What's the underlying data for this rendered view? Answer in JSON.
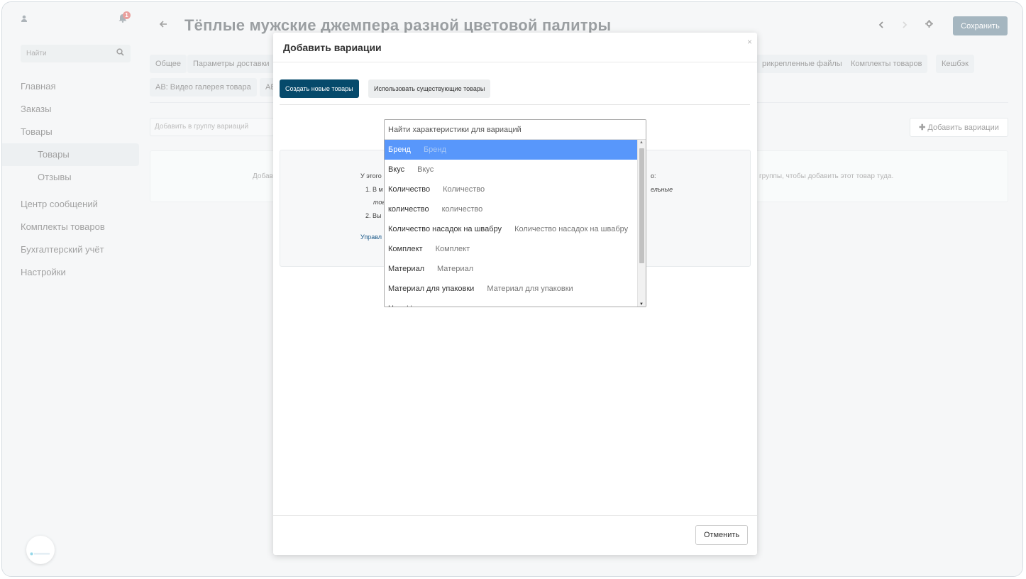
{
  "header": {
    "title": "Тёплые мужские джемпера разной цветовой палитры",
    "save_label": "Сохранить"
  },
  "sidebar": {
    "search_placeholder": "Найти",
    "notification_count": "1",
    "items": [
      {
        "label": "Главная"
      },
      {
        "label": "Заказы"
      },
      {
        "label": "Товары"
      },
      {
        "label": "Товары"
      },
      {
        "label": "Отзывы"
      },
      {
        "label": "Центр сообщений"
      },
      {
        "label": "Комплекты товаров"
      },
      {
        "label": "Бухгалтерский учёт"
      },
      {
        "label": "Настройки"
      }
    ]
  },
  "tabs": {
    "row1": [
      "Общее",
      "Параметры доставки",
      "рикрепленные файлы",
      "Комплекты товаров",
      "Кешбэк"
    ],
    "row2": [
      "AB: Видео галерея товара",
      "AB"
    ]
  },
  "variations": {
    "group_placeholder": "Добавить в группу вариаций",
    "add_button": "Добавить вариации",
    "info_left": "Добав",
    "info_right": "группы, чтобы добавить этот товар туда."
  },
  "modal": {
    "title": "Добавить вариации",
    "close": "×",
    "tab_create": "Создать новые товары",
    "tab_existing": "Использовать существующие товары",
    "panel_lines": [
      "У этого",
      "1. В м",
      "тов",
      "2. Вы",
      "Управл"
    ],
    "panel_right_1": "о:",
    "panel_right_2": "ельные",
    "cancel": "Отменить"
  },
  "dropdown": {
    "placeholder": "Найти характеристики для вариаций",
    "options": [
      {
        "name": "Бренд",
        "value": "Бренд"
      },
      {
        "name": "Вкус",
        "value": "Вкус"
      },
      {
        "name": "Количество",
        "value": "Количество"
      },
      {
        "name": "количество",
        "value": "количество"
      },
      {
        "name": "Количество насадок на швабру",
        "value": "Количество насадок на швабру"
      },
      {
        "name": "Комплект",
        "value": "Комплект"
      },
      {
        "name": "Материал",
        "value": "Материал"
      },
      {
        "name": "Материал для упаковки",
        "value": "Материал для упаковки"
      },
      {
        "name": "Н",
        "value": "Н"
      }
    ]
  },
  "colors": {
    "primary": "#064a6b",
    "save_button": "#5c7a8c",
    "highlight": "#5897fb",
    "badge": "#d9534f"
  }
}
